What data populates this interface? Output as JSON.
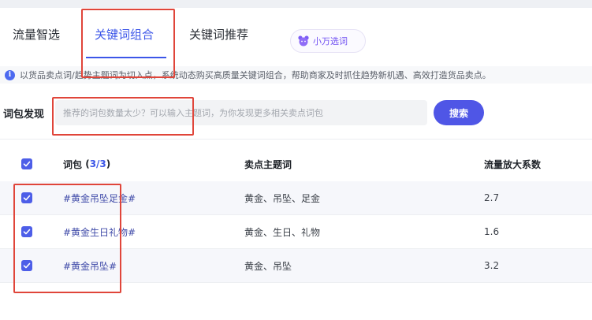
{
  "tabs": [
    {
      "label": "流量智选"
    },
    {
      "label": "关键词组合"
    },
    {
      "label": "关键词推荐"
    }
  ],
  "assistant_pill": {
    "label": "小万选词",
    "icon": "bear-icon"
  },
  "notice": {
    "icon": "info-icon",
    "text": "以货品卖点词/趋势主题词为切入点，系统动态购买高质量关键词组合，帮助商家及时抓住趋势新机遇、高效打造货品卖点。"
  },
  "search": {
    "label": "词包发现",
    "placeholder": "推荐的词包数量太少？可以输入主题词，为你发现更多相关卖点词包",
    "value": "",
    "button_label": "搜索"
  },
  "table": {
    "headers": {
      "word": "词包",
      "count_open": "(",
      "count": "3/3",
      "count_close": ")",
      "topic": "卖点主题词",
      "factor": "流量放大系数"
    },
    "rows": [
      {
        "word": "#黄金吊坠足金#",
        "topic": "黄金、吊坠、足金",
        "factor": "2.7",
        "checked": true
      },
      {
        "word": "#黄金生日礼物#",
        "topic": "黄金、生日、礼物",
        "factor": "1.6",
        "checked": true
      },
      {
        "word": "#黄金吊坠#",
        "topic": "黄金、吊坠",
        "factor": "3.2",
        "checked": true
      }
    ]
  },
  "colors": {
    "accent": "#3c56e8",
    "button": "#4f56e6",
    "highlight": "#e0453a",
    "checkbox": "#4d5ee8"
  }
}
